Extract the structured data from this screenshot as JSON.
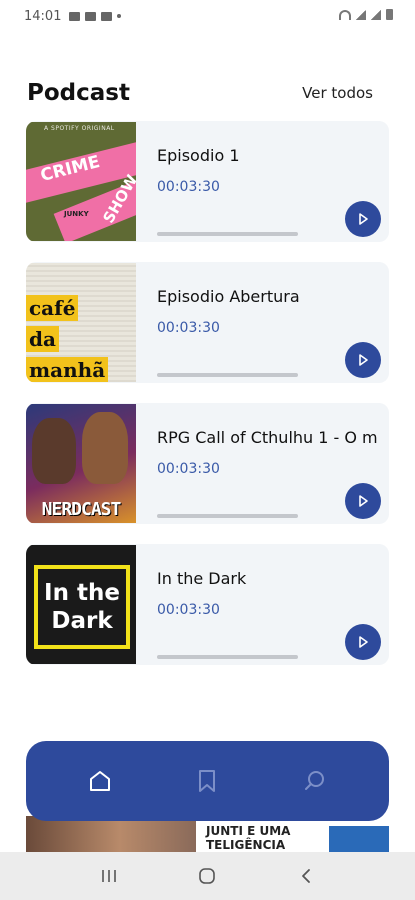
{
  "status_bar": {
    "time": "14:01"
  },
  "header": {
    "title": "Podcast",
    "see_all": "Ver todos"
  },
  "episodes": [
    {
      "title": "Episodio 1",
      "duration": "00:03:30",
      "progress": 0,
      "cover": "crime-show-cover"
    },
    {
      "title": "Episodio Abertura",
      "duration": "00:03:30",
      "progress": 0,
      "cover": "cafe-da-manha-cover"
    },
    {
      "title": "RPG Call of Cthulhu 1 - O m",
      "duration": "00:03:30",
      "progress": 0,
      "cover": "nerdcast-cover"
    },
    {
      "title": "In the Dark",
      "duration": "00:03:30",
      "progress": 0,
      "cover": "in-the-dark-cover"
    }
  ],
  "covers": {
    "crime": {
      "top": "A SPOTIFY ORIGINAL",
      "w1": "CRIME",
      "w2": "SHOW",
      "w3": "JUNKY"
    },
    "cafe": {
      "lines": [
        "café",
        "da",
        "manhã"
      ]
    },
    "nerd": {
      "label": "NERDCAST"
    },
    "dark": {
      "lines": [
        "In the",
        "Dark"
      ]
    }
  },
  "peek": {
    "text": "JUNTI E UMA\nTELIGÊNCIA\nRTIFICIAL"
  },
  "bottom_nav": {
    "items": [
      "home-icon",
      "bookmark-icon",
      "search-icon"
    ],
    "active": "home-icon"
  },
  "colors": {
    "accent": "#2e4a9c",
    "duration_text": "#3a5aa8",
    "card_bg": "#f2f5f8"
  }
}
